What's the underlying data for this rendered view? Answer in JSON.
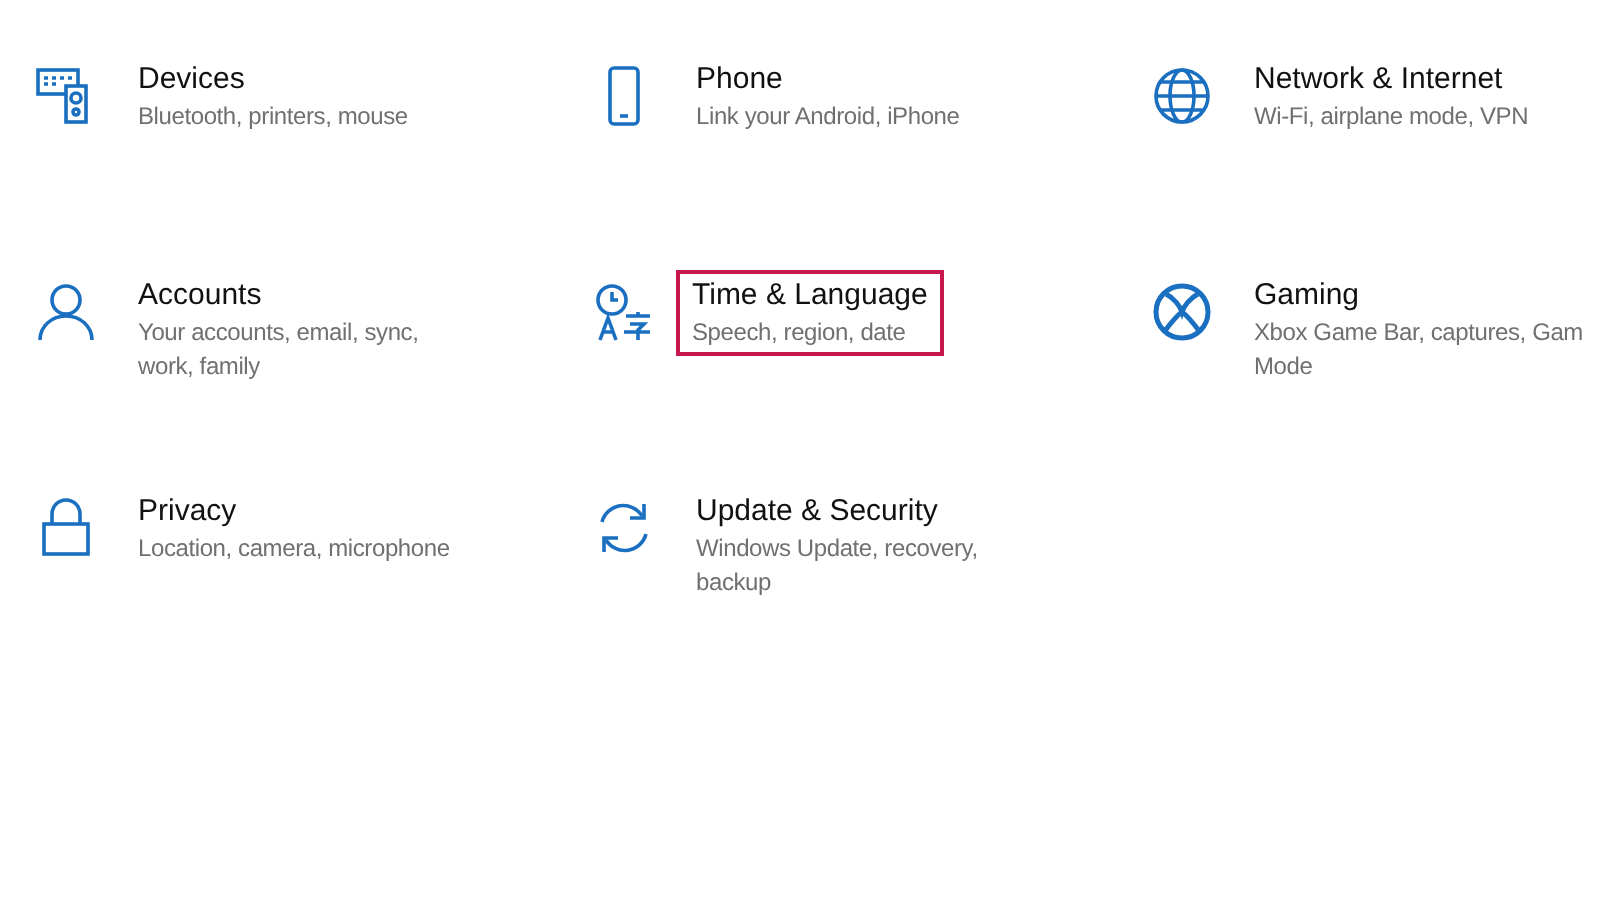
{
  "categories": [
    {
      "title": "Devices",
      "description_lines": [
        "Bluetooth, printers, mouse"
      ],
      "highlighted": false
    },
    {
      "title": "Phone",
      "description_lines": [
        "Link your Android, iPhone"
      ],
      "highlighted": false
    },
    {
      "title": "Network & Internet",
      "description_lines": [
        "Wi-Fi, airplane mode, VPN"
      ],
      "highlighted": false
    },
    {
      "title": "Accounts",
      "description_lines": [
        "Your accounts, email, sync,",
        "work, family"
      ],
      "highlighted": false
    },
    {
      "title": "Time & Language",
      "description_lines": [
        "Speech, region, date"
      ],
      "highlighted": true
    },
    {
      "title": "Gaming",
      "description_lines": [
        "Xbox Game Bar, captures, Gam",
        "Mode"
      ],
      "highlighted": false
    },
    {
      "title": "Privacy",
      "description_lines": [
        "Location, camera, microphone"
      ],
      "highlighted": false
    },
    {
      "title": "Update & Security",
      "description_lines": [
        "Windows Update, recovery,",
        "backup"
      ],
      "highlighted": false
    }
  ]
}
